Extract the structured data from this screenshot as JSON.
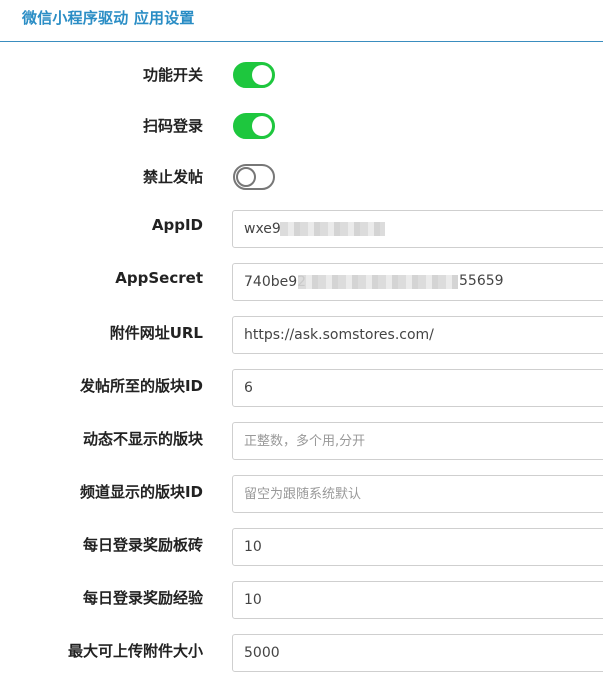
{
  "panel": {
    "title": "微信小程序驱动 应用设置"
  },
  "toggles": [
    {
      "label": "功能开关",
      "state": "on"
    },
    {
      "label": "扫码登录",
      "state": "on"
    },
    {
      "label": "禁止发帖",
      "state": "off"
    }
  ],
  "fields": {
    "appid": {
      "label": "AppID",
      "value": "wxe9"
    },
    "appsecret": {
      "label": "AppSecret",
      "value": "740be92",
      "value_suffix": "55659"
    },
    "attach_url": {
      "label": "附件网址URL",
      "value": "https://ask.somstores.com/"
    },
    "post_forum": {
      "label": "发帖所至的版块ID",
      "value": "6"
    },
    "hidden_forums": {
      "label": "动态不显示的版块",
      "value": "",
      "placeholder": "正整数，多个用,分开"
    },
    "channel_forums": {
      "label": "频道显示的版块ID",
      "value": "",
      "placeholder": "留空为跟随系统默认"
    },
    "daily_bricks": {
      "label": "每日登录奖励板砖",
      "value": "10"
    },
    "daily_exp": {
      "label": "每日登录奖励经验",
      "value": "10"
    },
    "max_upload": {
      "label": "最大可上传附件大小",
      "value": "5000"
    }
  },
  "colors": {
    "accent": "#2a8dc5",
    "toggle_on": "#1ec73e",
    "toggle_off_border": "#777777"
  }
}
